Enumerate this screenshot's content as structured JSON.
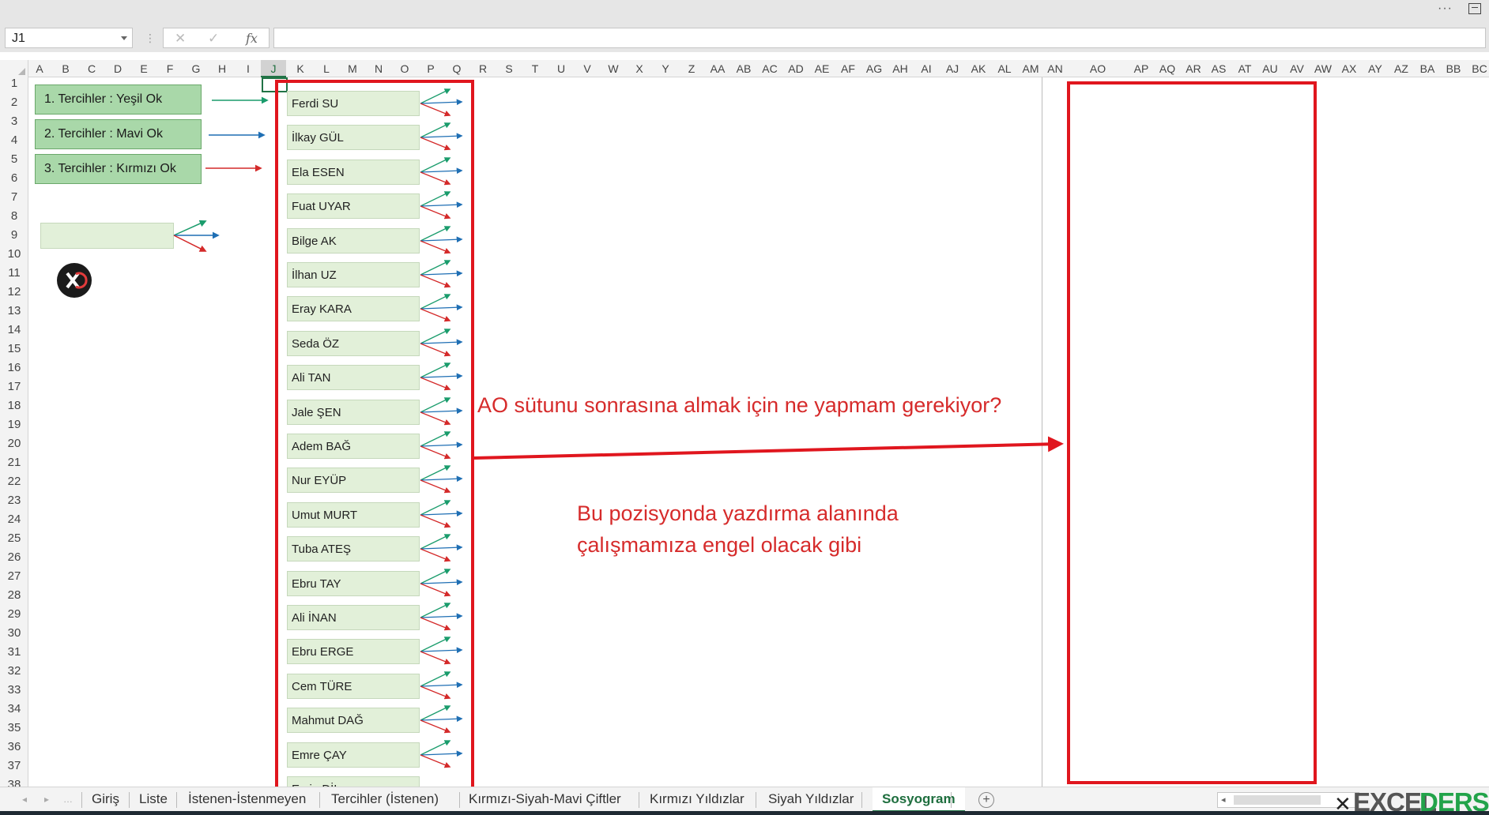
{
  "window": {
    "more_label": "···"
  },
  "formula_bar": {
    "name_box_value": "J1",
    "cancel_icon": "x-icon",
    "enter_icon": "check-icon",
    "function_label": "fx",
    "formula_value": ""
  },
  "columns": [
    "A",
    "B",
    "C",
    "D",
    "E",
    "F",
    "G",
    "H",
    "I",
    "J",
    "K",
    "L",
    "M",
    "N",
    "O",
    "P",
    "Q",
    "R",
    "S",
    "T",
    "U",
    "V",
    "W",
    "X",
    "Y",
    "Z",
    "AA",
    "AB",
    "AC",
    "AD",
    "AE",
    "AF",
    "AG",
    "AH",
    "AI",
    "AJ",
    "AK",
    "AL",
    "AM",
    "AN",
    "AO",
    "AP",
    "AQ",
    "AR",
    "AS",
    "AT",
    "AU",
    "AV",
    "AW",
    "AX",
    "AY",
    "AZ",
    "BA",
    "BB",
    "BC"
  ],
  "selected_column": "J",
  "rows": [
    "1",
    "2",
    "3",
    "4",
    "5",
    "6",
    "7",
    "8",
    "9",
    "10",
    "11",
    "12",
    "13",
    "14",
    "15",
    "16",
    "17",
    "18",
    "19",
    "20",
    "21",
    "22",
    "23",
    "24",
    "25",
    "26",
    "27",
    "28",
    "29",
    "30",
    "31",
    "32",
    "33",
    "34",
    "35",
    "36",
    "37",
    "38"
  ],
  "legend": {
    "green": "1. Tercihler : Yeşil Ok",
    "blue": "2. Tercihler : Mavi Ok",
    "red": "3. Tercihler : Kırmızı Ok"
  },
  "colors": {
    "green_arrow": "#1a9c6c",
    "blue_arrow": "#1f6fb4",
    "red_arrow": "#d42a2a",
    "accent": "#217346",
    "box_fill": "#e2f0d9",
    "legend_fill": "#a9d8a9"
  },
  "students": [
    "Ferdi SU",
    "İlkay GÜL",
    "Ela ESEN",
    "Fuat UYAR",
    "Bilge AK",
    "İlhan UZ",
    "Eray KARA",
    "Seda ÖZ",
    "Ali TAN",
    "Jale ŞEN",
    "Adem BAĞ",
    "Nur EYÜP",
    "Umut MURT",
    "Tuba ATEŞ",
    "Ebru TAY",
    "Ali İNAN",
    "Ebru ERGE",
    "Cem TÜRE",
    "Mahmut DAĞ",
    "Emre ÇAY",
    "Emin DİL"
  ],
  "annotations": {
    "question": "AO sütunu sonrasına almak için ne yapmam gerekiyor?",
    "note_line1": "Bu pozisyonda yazdırma alanında",
    "note_line2": "çalışmamıza engel olacak gibi"
  },
  "sheet_tabs": {
    "tabs": [
      "Giriş",
      "Liste",
      "İstenen-İstenmeyen",
      "Tercihler (İstenen)",
      "Kırmızı-Siyah-Mavi Çiftler",
      "Kırmızı Yıldızlar",
      "Siyah Yıldızlar",
      "Sosyogram"
    ],
    "active": "Sosyogram",
    "add_icon": "plus-circle-icon"
  },
  "watermark": {
    "part1": "EXCEL",
    "part2": "DERS"
  }
}
